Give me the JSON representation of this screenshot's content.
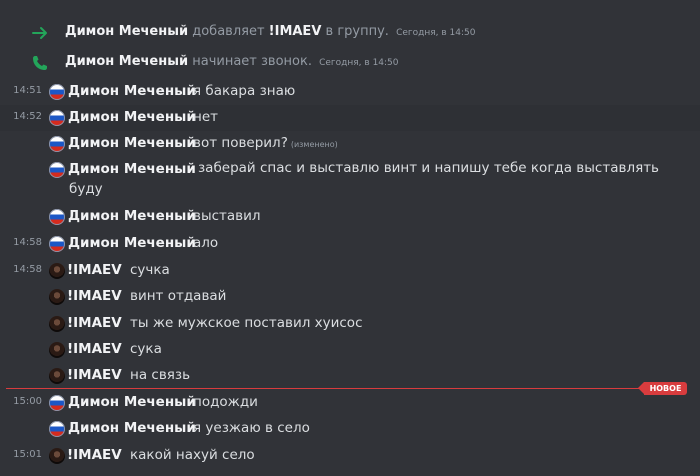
{
  "system": [
    {
      "author": "Димон Меченый",
      "action": "добавляет",
      "target": "!IMAEV",
      "suffix": "в группу.",
      "timestamp": "Сегодня, в 14:50",
      "icon": "arrow-right-icon"
    },
    {
      "author": "Димон Меченый",
      "action": "начинает звонок.",
      "timestamp": "Сегодня, в 14:50",
      "icon": "phone-icon"
    }
  ],
  "messages": [
    {
      "time": "14:51",
      "author": "Димон Меченый",
      "text": "я бакара знаю"
    },
    {
      "time": "14:52",
      "author": "Димон Меченый",
      "text": "нет"
    },
    {
      "time": "",
      "author": "Димон Меченый",
      "text": "вот поверил?",
      "edited": "(изменено)"
    },
    {
      "time": "",
      "author": "Димон Меченый",
      "text": "заберай спас и выставлю винт и напишу тебе когда выставлять буду"
    },
    {
      "time": "",
      "author": "Димон Меченый",
      "text": "выставил"
    },
    {
      "time": "14:58",
      "author": "Димон Меченый",
      "text": "ало"
    },
    {
      "time": "14:58",
      "author": "!IMAEV",
      "text": "сучка"
    },
    {
      "time": "",
      "author": "!IMAEV",
      "text": "винт отдавай"
    },
    {
      "time": "",
      "author": "!IMAEV",
      "text": "ты же мужское поставил хуисос"
    },
    {
      "time": "",
      "author": "!IMAEV",
      "text": "сука"
    },
    {
      "time": "",
      "author": "!IMAEV",
      "text": "на связь"
    },
    {
      "time": "15:00",
      "author": "Димон Меченый",
      "text": "подожди"
    },
    {
      "time": "",
      "author": "Димон Меченый",
      "text": "я уезжаю в село"
    },
    {
      "time": "15:01",
      "author": "!IMAEV",
      "text": "какой нахуй село"
    }
  ],
  "new_divider": {
    "label": "НОВОЕ"
  },
  "colors": {
    "background": "#313338",
    "new_divider": "#d83c3e",
    "join_icon": "#23a55a",
    "call_icon": "#23a55a"
  }
}
